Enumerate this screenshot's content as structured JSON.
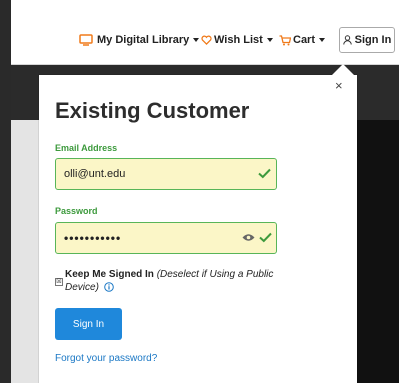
{
  "nav": {
    "library": "My Digital Library",
    "wishlist": "Wish List",
    "cart": "Cart",
    "signin": "Sign In"
  },
  "login": {
    "close_glyph": "×",
    "title": "Existing Customer",
    "email_label": "Email Address",
    "email_value": "olli@unt.edu",
    "password_label": "Password",
    "password_value": "•••••••••••",
    "remember_checked_glyph": "☒",
    "remember_label": "Keep Me Signed In",
    "remember_note": "(Deselect if Using a Public Device)",
    "submit_label": "Sign In",
    "forgot_link": "Forgot your password?"
  },
  "icons": {
    "library": "monitor-icon",
    "wishlist": "heart-icon",
    "cart": "cart-icon",
    "signin": "user-icon",
    "valid": "checkmark-icon",
    "reveal": "eye-icon",
    "info": "info-icon"
  },
  "colors": {
    "accent_orange": "#f07a1a",
    "valid_green": "#3d9a3d",
    "field_fill": "#fbf6c7",
    "button_blue": "#1f88db",
    "link_blue": "#1b78c5"
  }
}
